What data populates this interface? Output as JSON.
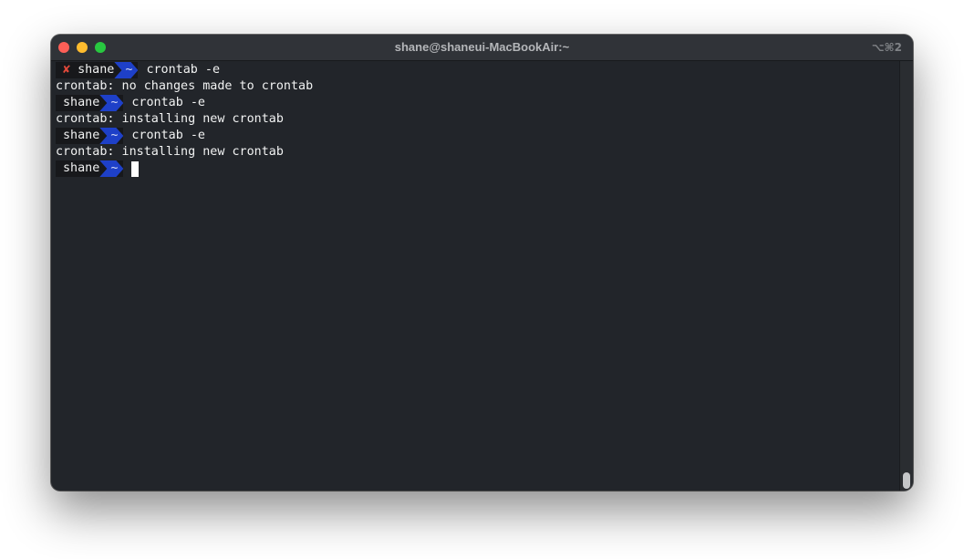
{
  "window": {
    "title": "shane@shaneui-MacBookAir:~",
    "shortcut": "⌥⌘2"
  },
  "prompt": {
    "user": "shane",
    "dir": "~",
    "error_mark": "✘"
  },
  "lines": [
    {
      "type": "prompt",
      "error": true,
      "command": "crontab -e"
    },
    {
      "type": "output",
      "text": "crontab: no changes made to crontab"
    },
    {
      "type": "prompt",
      "error": false,
      "command": "crontab -e"
    },
    {
      "type": "output",
      "text": "crontab: installing new crontab"
    },
    {
      "type": "prompt",
      "error": false,
      "command": "crontab -e"
    },
    {
      "type": "output",
      "text": "crontab: installing new crontab"
    },
    {
      "type": "prompt",
      "error": false,
      "command": ""
    }
  ],
  "colors": {
    "background": "#22252a",
    "dir_segment": "#1e40c8",
    "user_segment": "#17181b",
    "error": "#e0483a"
  }
}
